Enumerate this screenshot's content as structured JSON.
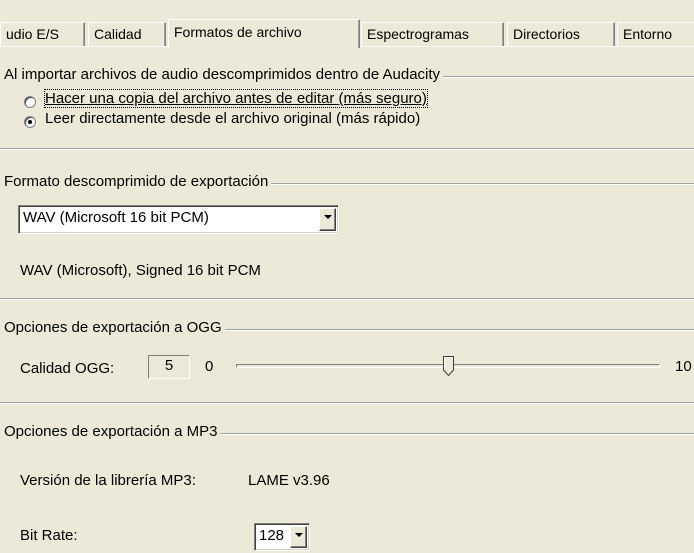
{
  "tabs": [
    {
      "label": "udio E/S",
      "active": false
    },
    {
      "label": "Calidad",
      "active": false
    },
    {
      "label": "Formatos de archivo",
      "active": true
    },
    {
      "label": "Espectrogramas",
      "active": false
    },
    {
      "label": "Directorios",
      "active": false
    },
    {
      "label": "Entorno",
      "active": false
    }
  ],
  "import_group": {
    "title": "Al importar archivos de audio descomprimidos dentro de Audacity",
    "options": [
      {
        "label": "Hacer una copia del archivo antes de editar (más seguro)",
        "selected": false
      },
      {
        "label": "Leer directamente desde el archivo original (más rápido)",
        "selected": true
      }
    ]
  },
  "export_format_group": {
    "title": "Formato descomprimido de exportación",
    "selected_format": "WAV (Microsoft 16 bit PCM)",
    "format_description": "WAV (Microsoft), Signed 16 bit PCM"
  },
  "ogg_group": {
    "title": "Opciones de exportación a OGG",
    "quality_label": "Calidad OGG:",
    "quality_value": "5",
    "slider_min": "0",
    "slider_max": "10",
    "slider_level": 5
  },
  "mp3_group": {
    "title": "Opciones de exportación a MP3",
    "library_version_label": "Versión de la librería MP3:",
    "library_version_value": "LAME v3.96",
    "bitrate_label": "Bit Rate:",
    "bitrate_value": "128"
  }
}
